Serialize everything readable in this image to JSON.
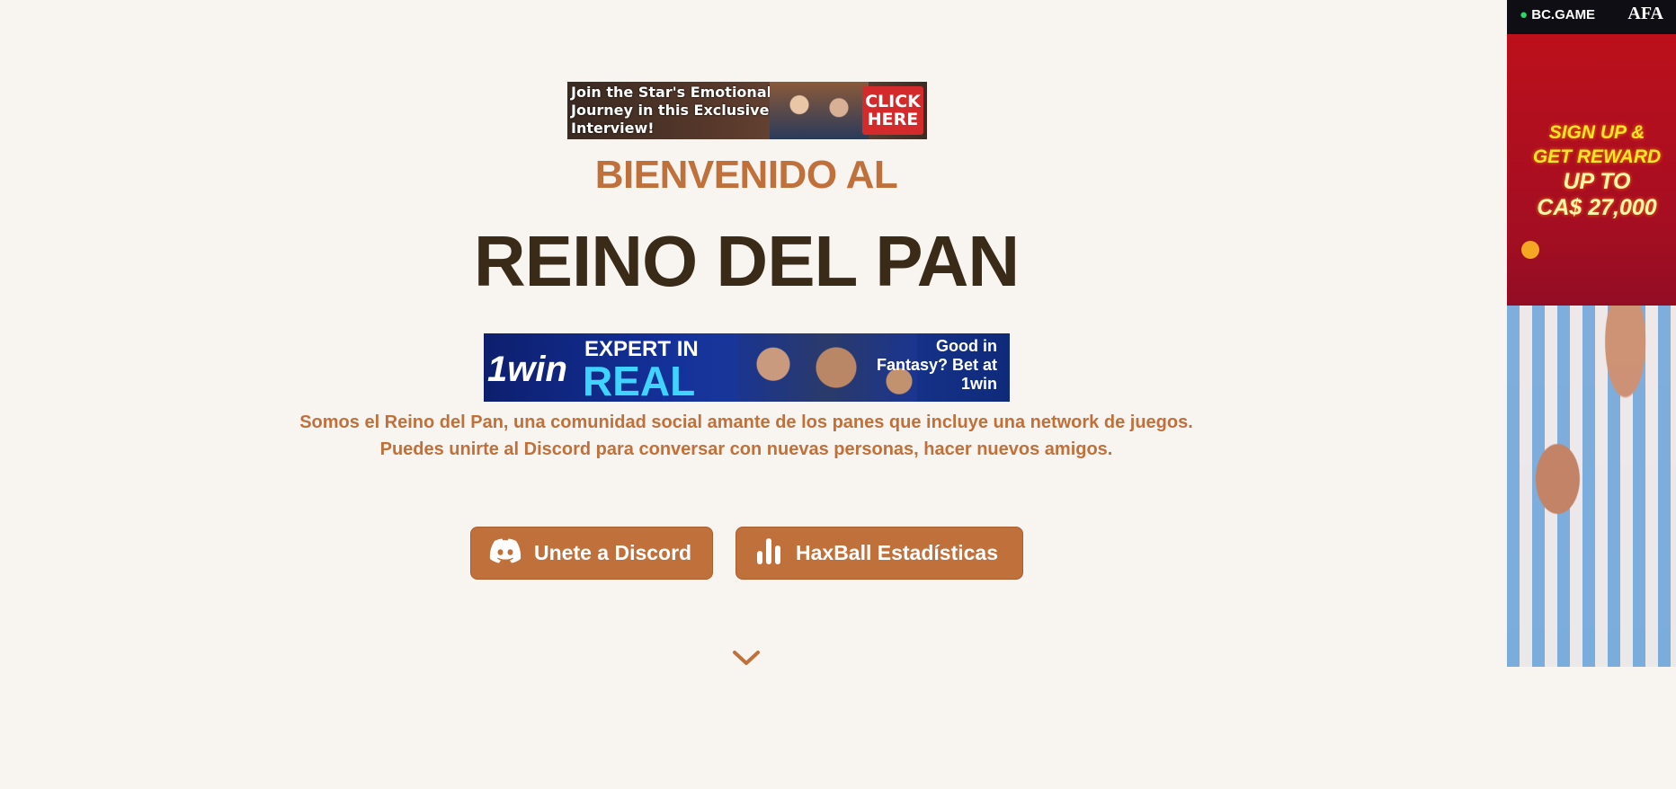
{
  "ads": {
    "top": {
      "text": "Join the Star's Emotional Journey in this Exclusive Interview!",
      "cta": "CLICK HERE"
    },
    "middle": {
      "logo": "1win",
      "line1": "EXPERT IN",
      "line2": "REAL",
      "right_text": "Good in Fantasy? Bet at 1win"
    },
    "side": {
      "brand": "BC.GAME",
      "partner": "AFA",
      "line1": "SIGN UP &",
      "line2": "GET REWARD",
      "line3": "UP TO",
      "line4": "CA$ 27,000"
    }
  },
  "hero": {
    "welcome": "BIENVENIDO AL",
    "title": "REINO DEL PAN",
    "description": "Somos el Reino del Pan, una comunidad social amante de los panes que incluye una network de juegos. Puedes unirte al Discord para conversar con nuevas personas, hacer nuevos amigos."
  },
  "buttons": {
    "discord": "Unete a Discord",
    "stats": "HaxBall Estadísticas"
  },
  "icons": {
    "discord": "discord-icon",
    "stats": "bar-chart-icon",
    "scroll": "chevron-down-icon"
  },
  "colors": {
    "background": "#f8f5f1",
    "accent": "#c0703b",
    "title": "#3a2a18"
  }
}
